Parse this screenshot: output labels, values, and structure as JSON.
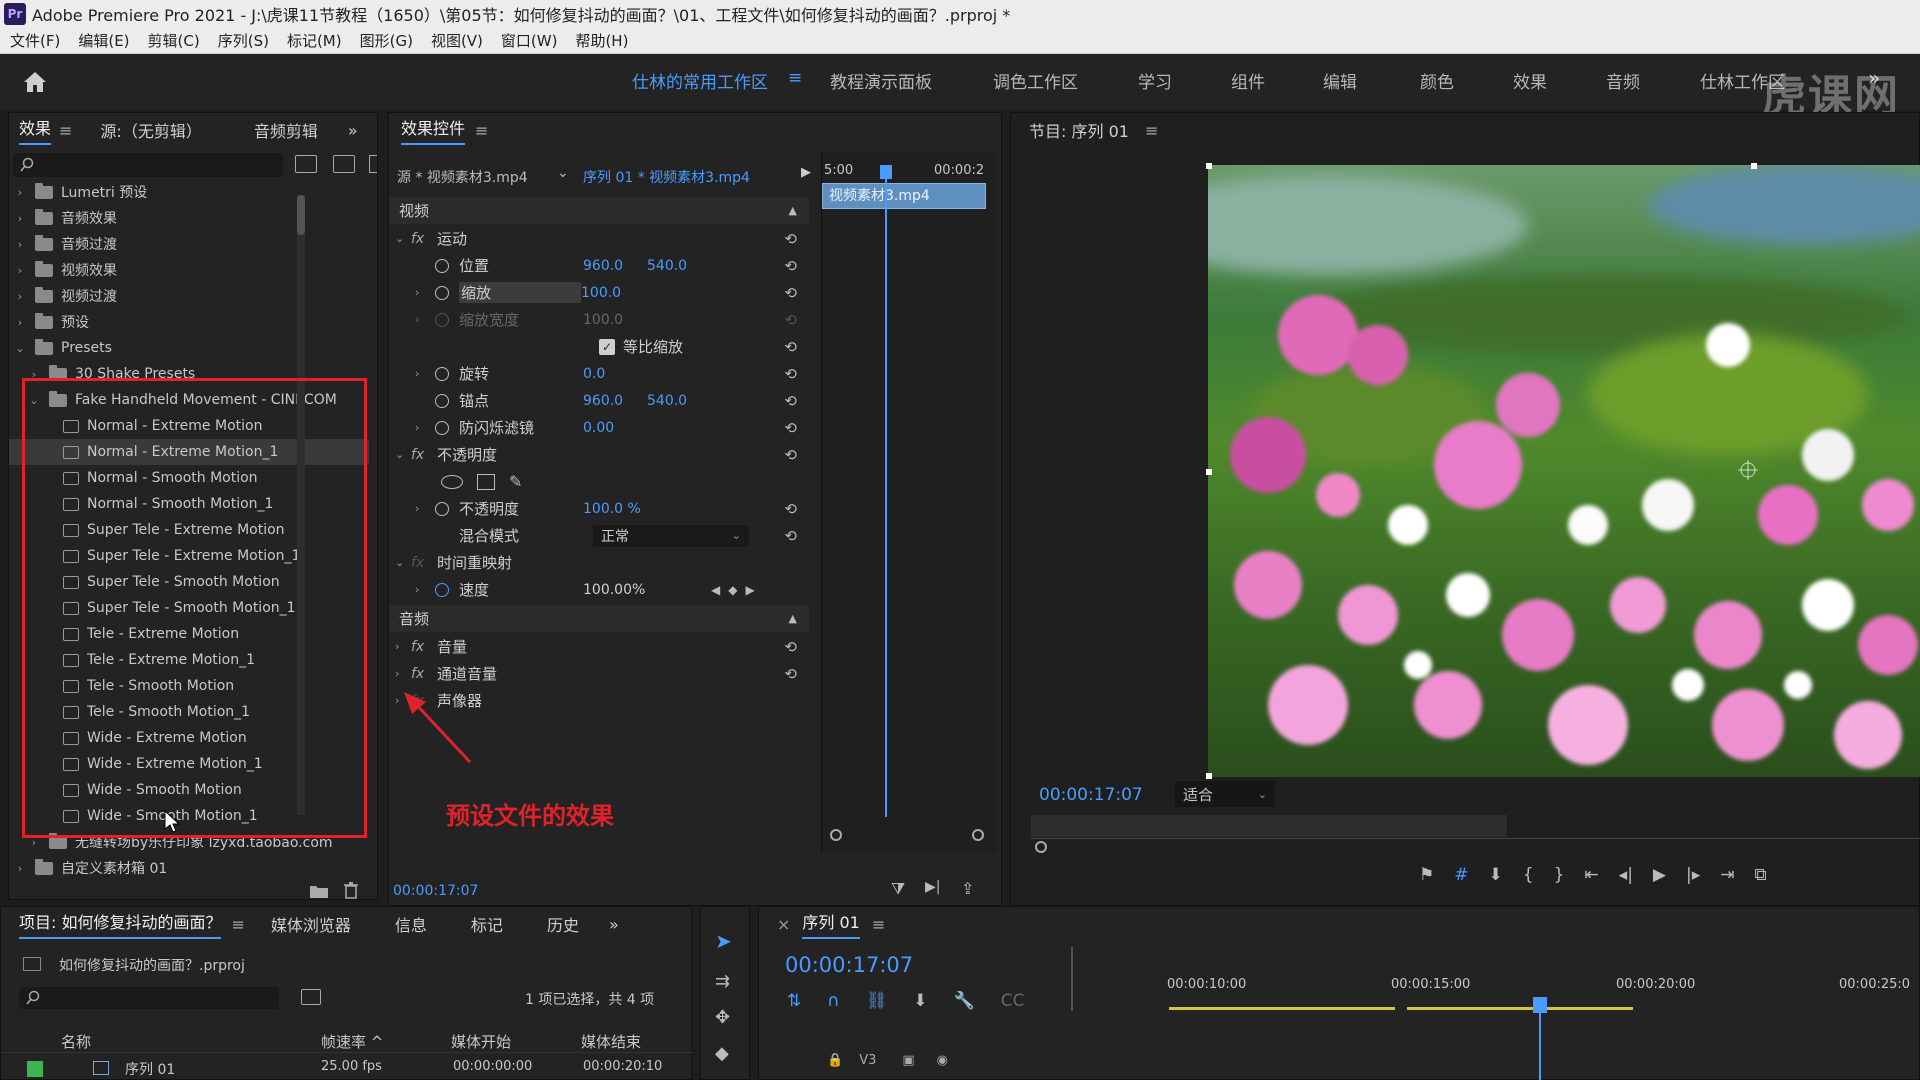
{
  "window": {
    "app_icon": "Pr",
    "title": "Adobe Premiere Pro 2021 - J:\\虎课11节教程（1650）\\第05节：如何修复抖动的画面？\\01、工程文件\\如何修复抖动的画面？.prproj *"
  },
  "menu": [
    "文件(F)",
    "编辑(E)",
    "剪辑(C)",
    "序列(S)",
    "标记(M)",
    "图形(G)",
    "视图(V)",
    "窗口(W)",
    "帮助(H)"
  ],
  "workspaces": {
    "active": "仕林的常用工作区",
    "items": [
      "教程演示面板",
      "调色工作区",
      "学习",
      "组件",
      "编辑",
      "颜色",
      "效果",
      "音频",
      "仕林工作区"
    ],
    "more": "»"
  },
  "watermark": "虎课网",
  "effects_panel": {
    "tabs": [
      "效果",
      "源:（无剪辑）",
      "音频剪辑"
    ],
    "more": "»",
    "tree": [
      {
        "label": "Lumetri 预设",
        "level": 0,
        "type": "folder",
        "chev": "›"
      },
      {
        "label": "音频效果",
        "level": 0,
        "type": "folder",
        "chev": "›"
      },
      {
        "label": "音频过渡",
        "level": 0,
        "type": "folder",
        "chev": "›"
      },
      {
        "label": "视频效果",
        "level": 0,
        "type": "folder",
        "chev": "›"
      },
      {
        "label": "视频过渡",
        "level": 0,
        "type": "folder",
        "chev": "›"
      },
      {
        "label": "预设",
        "level": 0,
        "type": "folder",
        "chev": "›"
      },
      {
        "label": "Presets",
        "level": 0,
        "type": "folder",
        "chev": "⌄"
      },
      {
        "label": "30 Shake Presets",
        "level": 1,
        "type": "folder",
        "chev": "›"
      },
      {
        "label": "Fake Handheld Movement - CINECOM.NET",
        "level": 1,
        "type": "folder",
        "chev": "⌄"
      },
      {
        "label": "Normal - Extreme Motion",
        "level": 2,
        "type": "preset"
      },
      {
        "label": "Normal - Extreme Motion_1",
        "level": 2,
        "type": "preset",
        "selected": true
      },
      {
        "label": "Normal - Smooth Motion",
        "level": 2,
        "type": "preset"
      },
      {
        "label": "Normal - Smooth Motion_1",
        "level": 2,
        "type": "preset"
      },
      {
        "label": "Super Tele - Extreme Motion",
        "level": 2,
        "type": "preset"
      },
      {
        "label": "Super Tele - Extreme Motion_1",
        "level": 2,
        "type": "preset"
      },
      {
        "label": "Super Tele - Smooth Motion",
        "level": 2,
        "type": "preset"
      },
      {
        "label": "Super Tele - Smooth Motion_1",
        "level": 2,
        "type": "preset"
      },
      {
        "label": "Tele - Extreme Motion",
        "level": 2,
        "type": "preset"
      },
      {
        "label": "Tele - Extreme Motion_1",
        "level": 2,
        "type": "preset"
      },
      {
        "label": "Tele - Smooth Motion",
        "level": 2,
        "type": "preset"
      },
      {
        "label": "Tele - Smooth Motion_1",
        "level": 2,
        "type": "preset"
      },
      {
        "label": "Wide - Extreme Motion",
        "level": 2,
        "type": "preset"
      },
      {
        "label": "Wide - Extreme Motion_1",
        "level": 2,
        "type": "preset"
      },
      {
        "label": "Wide - Smooth Motion",
        "level": 2,
        "type": "preset"
      },
      {
        "label": "Wide - Smooth Motion_1",
        "level": 2,
        "type": "preset"
      },
      {
        "label": "无缝转场by乐仔印象 lzyxd.taobao.com",
        "level": 1,
        "type": "folder",
        "chev": "›"
      },
      {
        "label": "自定义素材箱 01",
        "level": 0,
        "type": "folder",
        "chev": "›"
      }
    ]
  },
  "effect_controls": {
    "title": "效果控件",
    "source": "源 * 视频素材3.mp4",
    "sequence": "序列 01 * 视频素材3.mp4",
    "timecode_start": "5:00",
    "timecode_end": "00:00:2",
    "clip_name": "视频素材3.mp4",
    "video_label": "视频",
    "motion": "运动",
    "position_label": "位置",
    "position_x": "960.0",
    "position_y": "540.0",
    "scale_label": "缩放",
    "scale_value": "100.0",
    "scale_width_label": "缩放宽度",
    "scale_width_value": "100.0",
    "uniform_scale": "等比缩放",
    "rotation_label": "旋转",
    "rotation_value": "0.0",
    "anchor_label": "锚点",
    "anchor_x": "960.0",
    "anchor_y": "540.0",
    "antiflicker_label": "防闪烁滤镜",
    "antiflicker_value": "0.00",
    "opacity_group": "不透明度",
    "opacity_label": "不透明度",
    "opacity_value": "100.0 %",
    "blend_label": "混合模式",
    "blend_value": "正常",
    "time_remap": "时间重映射",
    "speed_label": "速度",
    "speed_value": "100.00%",
    "audio_label": "音频",
    "volume": "音量",
    "channel_volume": "通道音量",
    "panner": "声像器",
    "fx": "fx",
    "footer_timecode": "00:00:17:07"
  },
  "annotation": "预设文件的效果",
  "program_monitor": {
    "title": "节目: 序列 01",
    "timecode": "00:00:17:07",
    "fit": "适合"
  },
  "project_panel": {
    "tabs": [
      "项目: 如何修复抖动的画面？",
      "媒体浏览器",
      "信息",
      "标记",
      "历史"
    ],
    "more": "»",
    "file": "如何修复抖动的画面？.prproj",
    "selection_info": "1 项已选择，共 4 项",
    "columns": [
      "名称",
      "帧速率 ^",
      "媒体开始",
      "媒体结束"
    ],
    "row": {
      "name": "序列 01",
      "fps": "25.00 fps",
      "start": "00:00:00:00",
      "end": "00:00:20:10"
    }
  },
  "timeline": {
    "title": "序列 01",
    "timecode": "00:00:17:07",
    "ruler": [
      "00:00:10:00",
      "00:00:15:00",
      "00:00:20:00",
      "00:00:25:0"
    ],
    "track": "V3"
  }
}
